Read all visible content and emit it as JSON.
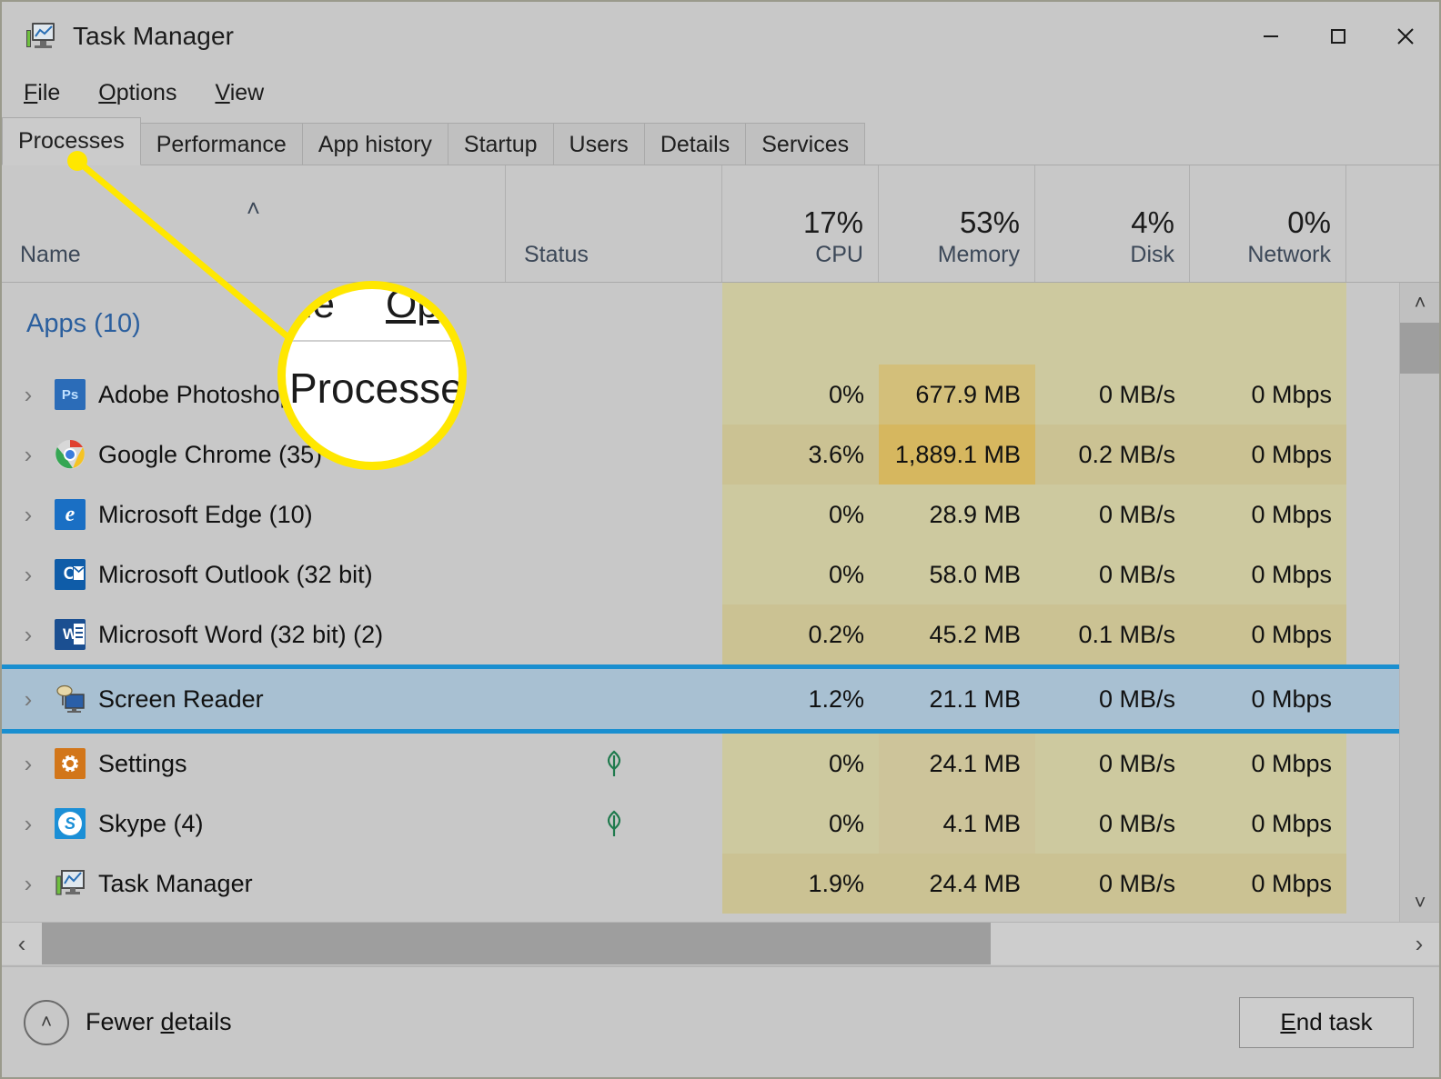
{
  "window": {
    "title": "Task Manager",
    "icon": "task-manager-icon",
    "controls": {
      "minimize": "—",
      "maximize": "□",
      "close": "✕"
    }
  },
  "menu": {
    "items": [
      {
        "pre": "F",
        "post": "ile",
        "name": "file"
      },
      {
        "pre": "O",
        "post": "ptions",
        "name": "options"
      },
      {
        "pre": "V",
        "post": "iew",
        "name": "view"
      }
    ]
  },
  "tabs": [
    {
      "label": "Processes",
      "active": true
    },
    {
      "label": "Performance",
      "active": false
    },
    {
      "label": "App history",
      "active": false
    },
    {
      "label": "Startup",
      "active": false
    },
    {
      "label": "Users",
      "active": false
    },
    {
      "label": "Details",
      "active": false
    },
    {
      "label": "Services",
      "active": false
    }
  ],
  "columns": [
    {
      "label": "Name",
      "value": "",
      "align": "left",
      "sort": "asc",
      "sort_glyph": "˄"
    },
    {
      "label": "Status",
      "value": "",
      "align": "left"
    },
    {
      "label": "CPU",
      "value": "17%",
      "align": "right"
    },
    {
      "label": "Memory",
      "value": "53%",
      "align": "right"
    },
    {
      "label": "Disk",
      "value": "4%",
      "align": "right"
    },
    {
      "label": "Network",
      "value": "0%",
      "align": "right"
    }
  ],
  "group": {
    "label": "Apps (10)"
  },
  "processes": [
    {
      "name": "Adobe Photoshop",
      "icon": "photoshop-icon",
      "icon_text": "Ps",
      "icon_bg": "#2b6cb8",
      "status": "",
      "cpu": "0%",
      "memory": "677.9 MB",
      "disk": "0 MB/s",
      "network": "0 Mbps",
      "selected": false,
      "cpu_shade": "#cdc99f",
      "mem_shade": "#d3bf7a",
      "disk_shade": "#cdc99f",
      "net_shade": "#cdc99f"
    },
    {
      "name": "Google Chrome (35)",
      "icon": "chrome-icon",
      "icon_text": "",
      "icon_bg": "transparent",
      "status": "",
      "cpu": "3.6%",
      "memory": "1,889.1 MB",
      "disk": "0.2 MB/s",
      "network": "0 Mbps",
      "selected": false,
      "cpu_shade": "#cbc293",
      "mem_shade": "#d6b75f",
      "disk_shade": "#cbc293",
      "net_shade": "#cbc293"
    },
    {
      "name": "Microsoft Edge (10)",
      "icon": "edge-icon",
      "icon_text": "e",
      "icon_bg": "#1a6fc4",
      "status": "",
      "cpu": "0%",
      "memory": "28.9 MB",
      "disk": "0 MB/s",
      "network": "0 Mbps",
      "selected": false,
      "cpu_shade": "#cdc99f",
      "mem_shade": "#cdc99f",
      "disk_shade": "#cdc99f",
      "net_shade": "#cdc99f"
    },
    {
      "name": "Microsoft Outlook (32 bit)",
      "icon": "outlook-icon",
      "icon_text": "O",
      "icon_bg": "#0f5ca8",
      "status": "",
      "cpu": "0%",
      "memory": "58.0 MB",
      "disk": "0 MB/s",
      "network": "0 Mbps",
      "selected": false,
      "cpu_shade": "#cdc99f",
      "mem_shade": "#cdc99f",
      "disk_shade": "#cdc99f",
      "net_shade": "#cdc99f"
    },
    {
      "name": "Microsoft Word (32 bit) (2)",
      "icon": "word-icon",
      "icon_text": "W",
      "icon_bg": "#1b4f91",
      "status": "",
      "cpu": "0.2%",
      "memory": "45.2 MB",
      "disk": "0.1 MB/s",
      "network": "0 Mbps",
      "selected": false,
      "cpu_shade": "#cbc293",
      "mem_shade": "#cbc293",
      "disk_shade": "#cbc293",
      "net_shade": "#cbc293"
    },
    {
      "name": "Screen Reader",
      "icon": "screen-reader-icon",
      "icon_text": "",
      "icon_bg": "transparent",
      "status": "",
      "cpu": "1.2%",
      "memory": "21.1 MB",
      "disk": "0 MB/s",
      "network": "0 Mbps",
      "selected": true,
      "cpu_shade": "transparent",
      "mem_shade": "transparent",
      "disk_shade": "transparent",
      "net_shade": "transparent"
    },
    {
      "name": "Settings",
      "icon": "settings-gear-icon",
      "icon_text": "",
      "icon_bg": "#d2761a",
      "status": "suspended-leaf-icon",
      "cpu": "0%",
      "memory": "24.1 MB",
      "disk": "0 MB/s",
      "network": "0 Mbps",
      "selected": false,
      "cpu_shade": "#cdc99f",
      "mem_shade": "#cdc49a",
      "disk_shade": "#cdc99f",
      "net_shade": "#cdc99f"
    },
    {
      "name": "Skype (4)",
      "icon": "skype-icon",
      "icon_text": "S",
      "icon_bg": "#1b8fd6",
      "status": "suspended-leaf-icon",
      "cpu": "0%",
      "memory": "4.1 MB",
      "disk": "0 MB/s",
      "network": "0 Mbps",
      "selected": false,
      "cpu_shade": "#cdc99f",
      "mem_shade": "#cdc49a",
      "disk_shade": "#cdc99f",
      "net_shade": "#cdc99f"
    },
    {
      "name": "Task Manager",
      "icon": "task-manager-icon",
      "icon_text": "",
      "icon_bg": "transparent",
      "status": "",
      "cpu": "1.9%",
      "memory": "24.4 MB",
      "disk": "0 MB/s",
      "network": "0 Mbps",
      "selected": false,
      "cpu_shade": "#cbc293",
      "mem_shade": "#cbc293",
      "disk_shade": "#cbc293",
      "net_shade": "#cbc293"
    }
  ],
  "scrollbars": {
    "vertical_up": "˄",
    "vertical_down": "˅",
    "horizontal_left": "‹",
    "horizontal_right": "›"
  },
  "footer": {
    "fewer_details_pre": "Fewer ",
    "fewer_details_accel": "d",
    "fewer_details_post": "etails",
    "chevron": "˄",
    "end_task_pre": "E",
    "end_task_post": "nd task"
  },
  "callout": {
    "magnified_menu_left": "ile",
    "magnified_menu_right": "Op",
    "magnified_tab": "Processes",
    "highlight_color": "#ffe700"
  }
}
